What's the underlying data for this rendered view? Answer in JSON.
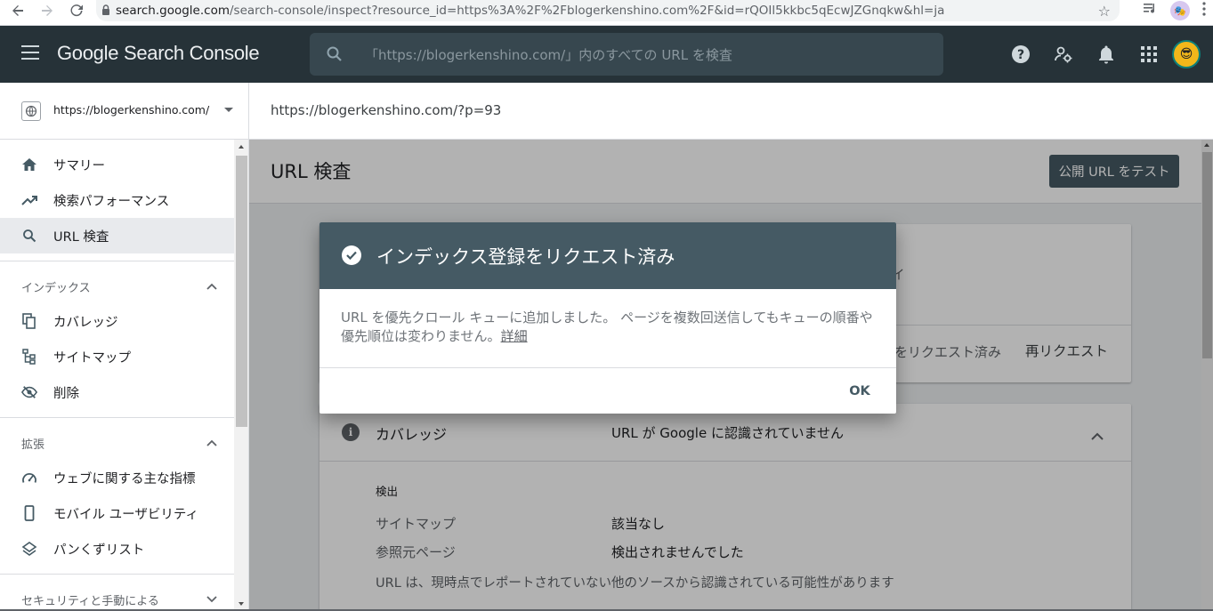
{
  "browser": {
    "address_host": "search.google.com",
    "address_path": "/search-console/inspect?resource_id=https%3A%2F%2Fblogerkenshino.com%2F&id=rQOIl5kkbc5qEcwJZGnqkw&hl=ja"
  },
  "header": {
    "brand": "Google Search Console",
    "search_placeholder": "「https://blogerkenshino.com/」内のすべての URL を検査"
  },
  "property": {
    "name": "https://blogerkenshino.com/"
  },
  "inspected_url": "https://blogerkenshino.com/?p=93",
  "sidebar": {
    "items_top": [
      {
        "label": "サマリー",
        "icon": "home-icon"
      },
      {
        "label": "検索パフォーマンス",
        "icon": "trending-up-icon"
      },
      {
        "label": "URL 検査",
        "icon": "search-icon"
      }
    ],
    "section_index": "インデックス",
    "items_index": [
      {
        "label": "カバレッジ",
        "icon": "file-copy-icon"
      },
      {
        "label": "サイトマップ",
        "icon": "sitemap-icon"
      },
      {
        "label": "削除",
        "icon": "visibility-off-icon"
      }
    ],
    "section_enh": "拡張",
    "items_enh": [
      {
        "label": "ウェブに関する主な指標",
        "icon": "speed-icon"
      },
      {
        "label": "モバイル ユーザビリティ",
        "icon": "smartphone-icon"
      },
      {
        "label": "パンくずリスト",
        "icon": "layers-icon"
      }
    ],
    "section_security": "セキュリティと手動による"
  },
  "main": {
    "title": "URL 検査",
    "test_button": "公開 URL をテスト",
    "card1_fragment": "イ",
    "card1_requested": "をリクエスト済み",
    "card1_rerequest": "再リクエスト",
    "coverage_title": "カバレッジ",
    "coverage_status": "URL が Google に認識されていません",
    "detect_label": "検出",
    "rows": [
      {
        "key": "サイトマップ",
        "value": "該当なし"
      },
      {
        "key": "参照元ページ",
        "value": "検出されませんでした"
      }
    ],
    "note": "URL は、現時点でレポートされていない他のソースから認識されている可能性があります"
  },
  "dialog": {
    "title": "インデックス登録をリクエスト済み",
    "body": "URL を優先クロール キューに追加しました。 ページを複数回送信してもキューの順番や優先順位は変わりません。",
    "link": "詳細",
    "ok": "OK"
  },
  "colors": {
    "appbar": "#263238",
    "dialog_header": "#455a64",
    "button": "#455a64"
  }
}
